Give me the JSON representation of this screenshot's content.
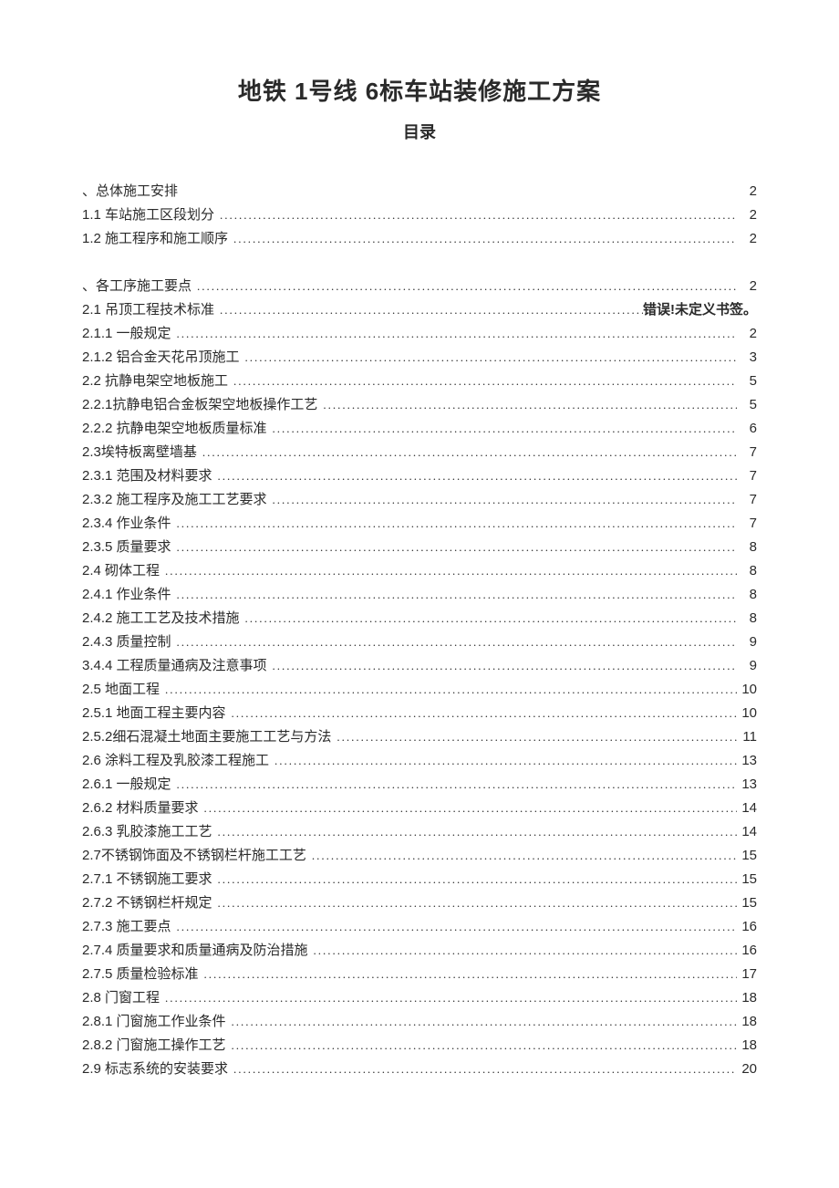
{
  "title": "地铁 1号线 6标车站装修施工方案",
  "subtitle": "目录",
  "toc": [
    {
      "label": "、总体施工安排",
      "page": "2",
      "dots": false,
      "head": true
    },
    {
      "label": "1.1 车站施工区段划分",
      "page": "2",
      "dots": true
    },
    {
      "label": "1.2 施工程序和施工顺序",
      "page": "2",
      "dots": true
    },
    {
      "spacer": true
    },
    {
      "label": "、各工序施工要点",
      "page": "2",
      "dots": true,
      "head": true
    },
    {
      "label": "2.1 吊顶工程技术标准",
      "page": "错误!未定义书签。",
      "dots": true,
      "err": true
    },
    {
      "label": "2.1.1 一般规定",
      "page": "2",
      "dots": true
    },
    {
      "label": "2.1.2 铝合金天花吊顶施工",
      "page": "3",
      "dots": true
    },
    {
      "label": "2.2 抗静电架空地板施工",
      "page": "5",
      "dots": true
    },
    {
      "label": "2.2.1抗静电铝合金板架空地板操作工艺",
      "page": "5",
      "dots": true
    },
    {
      "label": "2.2.2 抗静电架空地板质量标准",
      "page": "6",
      "dots": true
    },
    {
      "label": "2.3埃特板离壁墙基",
      "page": "7",
      "dots": true
    },
    {
      "label": "2.3.1 范围及材料要求",
      "page": "7",
      "dots": true
    },
    {
      "label": "2.3.2 施工程序及施工工艺要求",
      "page": "7",
      "dots": true
    },
    {
      "label": "2.3.4 作业条件",
      "page": "7",
      "dots": true
    },
    {
      "label": "2.3.5 质量要求",
      "page": "8",
      "dots": true
    },
    {
      "label": "2.4 砌体工程",
      "page": "8",
      "dots": true
    },
    {
      "label": "2.4.1 作业条件",
      "page": "8",
      "dots": true
    },
    {
      "label": "2.4.2 施工工艺及技术措施",
      "page": "8",
      "dots": true
    },
    {
      "label": "2.4.3 质量控制",
      "page": "9",
      "dots": true
    },
    {
      "label": "3.4.4 工程质量通病及注意事项",
      "page": "9",
      "dots": true
    },
    {
      "label": "2.5 地面工程",
      "page": "10",
      "dots": true
    },
    {
      "label": "2.5.1 地面工程主要内容",
      "page": "10",
      "dots": true
    },
    {
      "label": "2.5.2细石混凝土地面主要施工工艺与方法",
      "page": "11",
      "dots": true
    },
    {
      "label": "2.6 涂料工程及乳胶漆工程施工",
      "page": "13",
      "dots": true
    },
    {
      "label": "2.6.1 一般规定",
      "page": "13",
      "dots": true
    },
    {
      "label": "2.6.2 材料质量要求",
      "page": "14",
      "dots": true
    },
    {
      "label": "2.6.3 乳胶漆施工工艺",
      "page": "14",
      "dots": true
    },
    {
      "label": "2.7不锈钢饰面及不锈钢栏杆施工工艺",
      "page": "15",
      "dots": true
    },
    {
      "label": "2.7.1 不锈钢施工要求",
      "page": "15",
      "dots": true
    },
    {
      "label": "2.7.2 不锈钢栏杆规定",
      "page": "15",
      "dots": true
    },
    {
      "label": "2.7.3 施工要点",
      "page": "16",
      "dots": true
    },
    {
      "label": "2.7.4 质量要求和质量通病及防治措施",
      "page": "16",
      "dots": true
    },
    {
      "label": "2.7.5 质量检验标准",
      "page": "17",
      "dots": true
    },
    {
      "label": "2.8 门窗工程",
      "page": "18",
      "dots": true
    },
    {
      "label": "2.8.1 门窗施工作业条件",
      "page": "18",
      "dots": true
    },
    {
      "label": "2.8.2 门窗施工操作工艺",
      "page": "18",
      "dots": true
    },
    {
      "label": "2.9 标志系统的安装要求",
      "page": "20",
      "dots": true
    }
  ]
}
